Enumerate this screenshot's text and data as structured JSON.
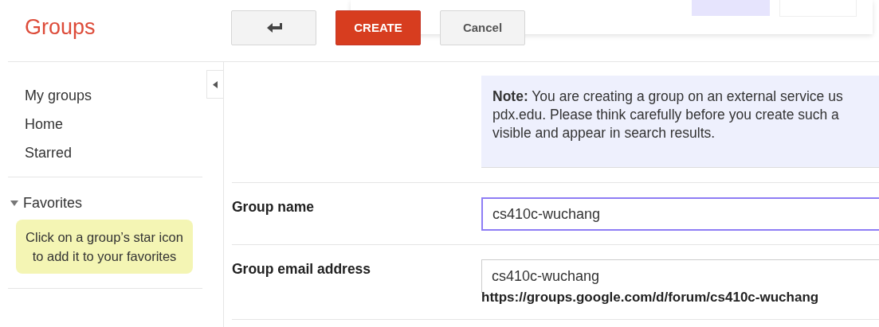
{
  "app_title": "Groups",
  "toolbar": {
    "back_button": {
      "kind": "back"
    },
    "create_button": "CREATE",
    "cancel_button": "Cancel"
  },
  "sidebar": {
    "items": [
      {
        "label": "My groups"
      },
      {
        "label": "Home"
      },
      {
        "label": "Starred"
      }
    ],
    "favorites": {
      "label": "Favorites",
      "expanded": true,
      "hint": "Click on a group’s star icon to add it to your favorites"
    }
  },
  "note": {
    "lines": [
      "**Note:** You are creating a group on an external service us",
      "pdx.edu. Please think carefully before you create such a",
      "visible and appear in search results."
    ]
  },
  "form": {
    "fields": [
      {
        "label": "Group name",
        "value": "cs410c-wuchang",
        "focused": true
      },
      {
        "label": "Group email address",
        "value": "cs410c-wuchang",
        "focused": false,
        "url": "https://groups.google.com/d/forum/cs410c-wuchang"
      }
    ]
  }
}
